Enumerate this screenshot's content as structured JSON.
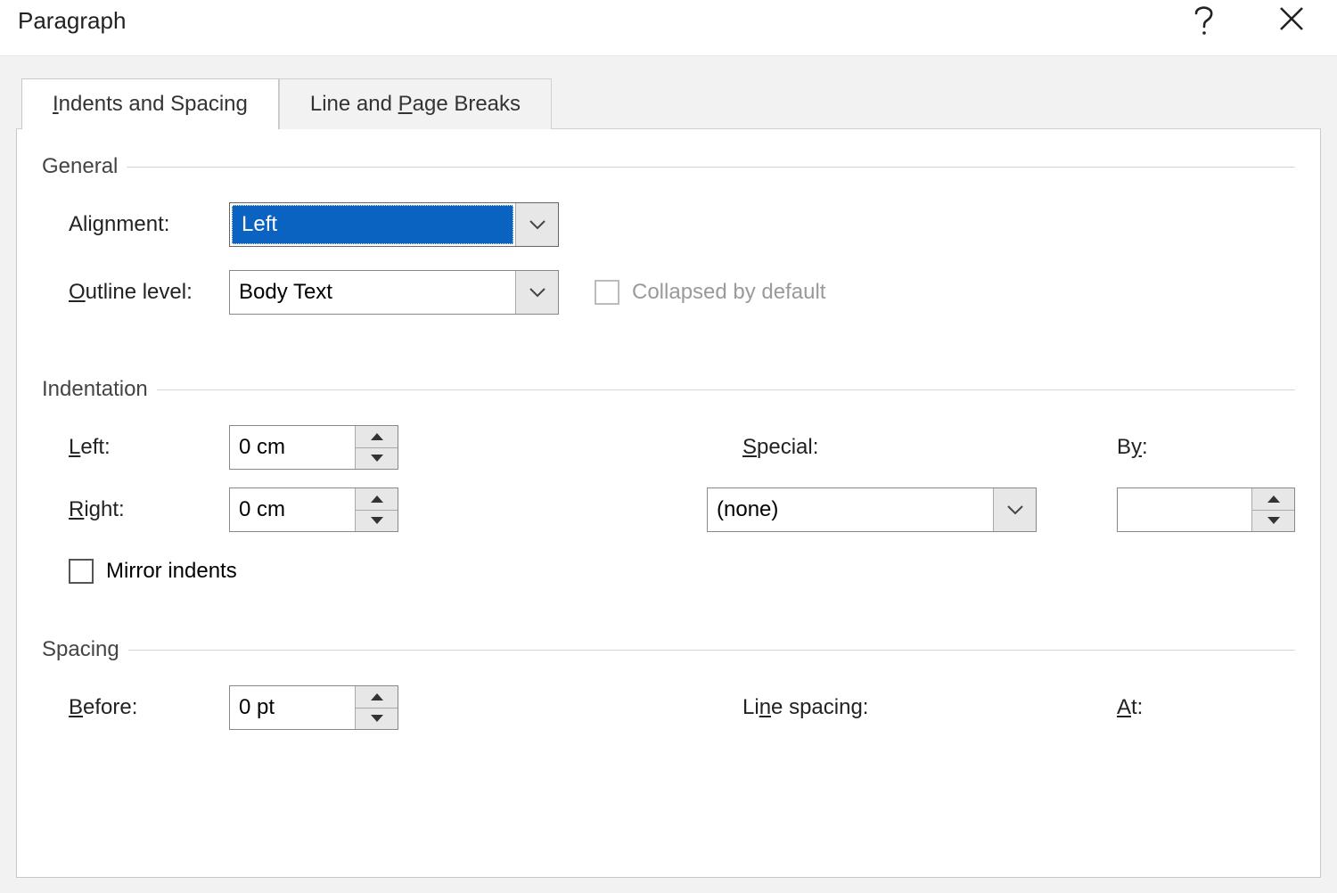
{
  "title": "Paragraph",
  "tabs": {
    "indents": {
      "pre": "",
      "u": "I",
      "post": "ndents and Spacing"
    },
    "breaks": {
      "pre": "Line and ",
      "u": "P",
      "post": "age Breaks"
    }
  },
  "general": {
    "title": "General",
    "alignment_label": {
      "pre": "Ali",
      "u": "g",
      "post": "nment:"
    },
    "alignment_value": "Left",
    "outline_label": {
      "pre": "",
      "u": "O",
      "post": "utline level:"
    },
    "outline_value": "Body Text",
    "collapsed_label": "Collapsed by default"
  },
  "indent": {
    "title": "Indentation",
    "left_label": {
      "pre": "",
      "u": "L",
      "post": "eft:"
    },
    "left_value": "0 cm",
    "right_label": {
      "pre": "",
      "u": "R",
      "post": "ight:"
    },
    "right_value": "0 cm",
    "special_label": {
      "pre": "",
      "u": "S",
      "post": "pecial:"
    },
    "special_value": "(none)",
    "by_label": {
      "pre": "B",
      "u": "y",
      "post": ":"
    },
    "by_value": "",
    "mirror_label": {
      "pre": "",
      "u": "M",
      "post": "irror indents"
    }
  },
  "spacing": {
    "title": "Spacing",
    "before_label": {
      "pre": "",
      "u": "B",
      "post": "efore:"
    },
    "before_value": "0 pt",
    "line_label": {
      "pre": "Li",
      "u": "n",
      "post": "e spacing:"
    },
    "at_label": {
      "pre": "",
      "u": "A",
      "post": "t:"
    }
  }
}
